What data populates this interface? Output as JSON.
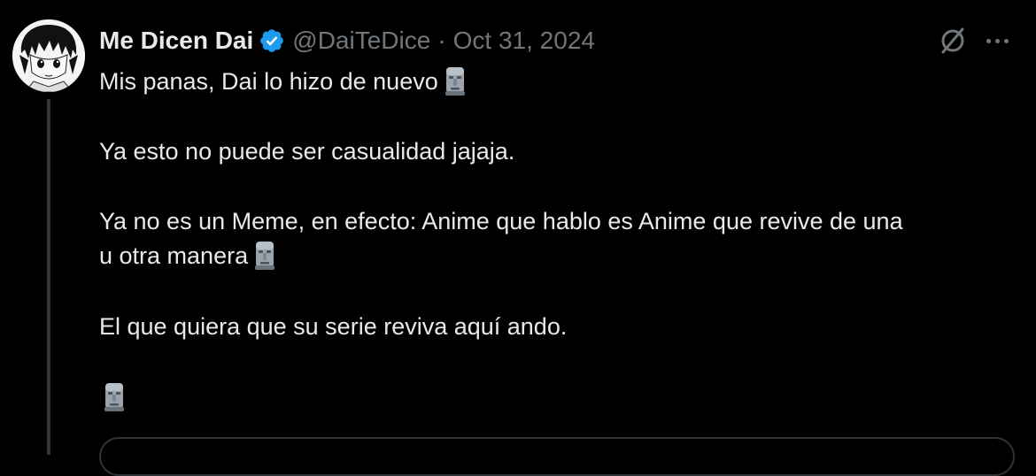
{
  "post": {
    "author_name": "Me Dicen Dai",
    "handle": "@DaiTeDice",
    "separator": "·",
    "date": "Oct 31, 2024",
    "lines": [
      "Mis panas, Dai lo hizo de nuevo",
      "Ya esto no puede ser casualidad jajaja.",
      "Ya no es un Meme, en efecto: Anime que hablo es Anime que revive de una",
      "u otra manera",
      "El que quiera que su serie reviva aquí ando."
    ],
    "emoji": "moai",
    "verified_color": "#1d9bf0"
  },
  "colors": {
    "background": "#000000",
    "text": "#e7e9ea",
    "secondary": "#71767b",
    "border": "#2f3336"
  }
}
